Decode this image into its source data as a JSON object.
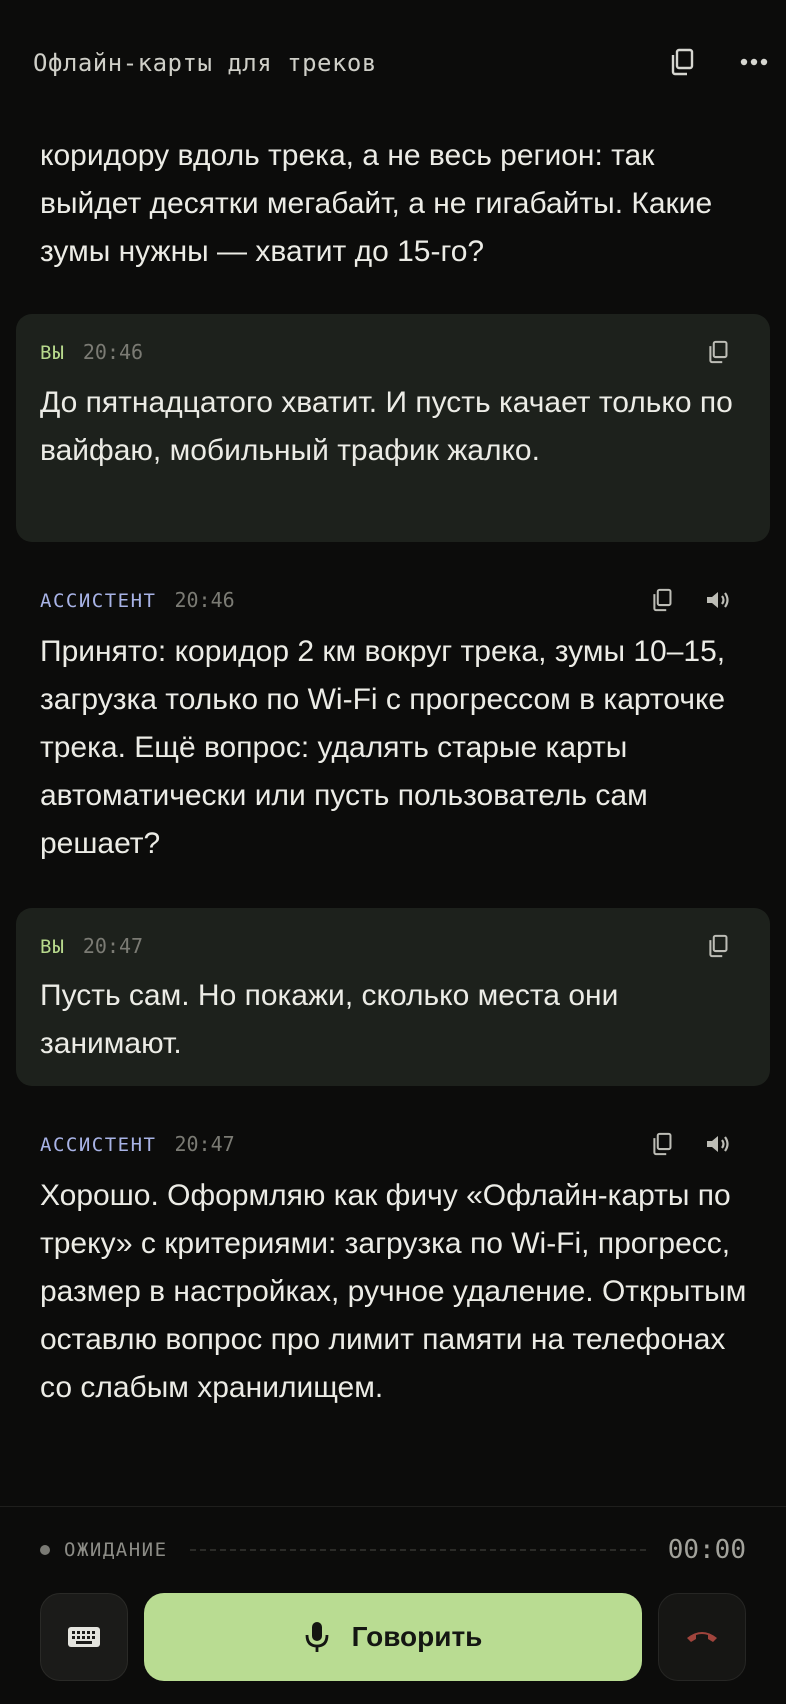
{
  "header": {
    "title": "Офлайн-карты для треков",
    "copy_icon": "copy-icon",
    "more_icon": "more-horizontal-icon"
  },
  "messages": [
    {
      "role": "assistant",
      "text": "коридору вдоль трека, а не весь регион: так выйдет десятки мегабайт, а не гигабайты. Какие зумы нужны — хватит до 15-го?"
    },
    {
      "role": "user",
      "role_label": "ВЫ",
      "time": "20:46",
      "text": "До пятнадцатого хватит. И пусть качает только по вайфаю, мобильный трафик жалко."
    },
    {
      "role": "assistant",
      "role_label": "АССИСТЕНТ",
      "time": "20:46",
      "text": "Принято: коридор 2 км вокруг трека, зумы 10–15, загрузка только по Wi-Fi с прогрессом в карточке трека. Ещё вопрос: удалять старые карты автоматически или пусть пользователь сам решает?"
    },
    {
      "role": "user",
      "role_label": "ВЫ",
      "time": "20:47",
      "text": "Пусть сам. Но покажи, сколько места они занимают."
    },
    {
      "role": "assistant",
      "role_label": "АССИСТЕНТ",
      "time": "20:47",
      "text": "Хорошо. Оформляю как фичу «Офлайн-карты по треку» с критериями: загрузка по Wi-Fi, прогресс, размер в настройках, ручное удаление. Открытым оставлю вопрос про лимит памяти на телефонах со слабым хранилищем."
    }
  ],
  "status": {
    "label": "ОЖИДАНИЕ",
    "timer": "00:00"
  },
  "controls": {
    "speak_label": "Говорить",
    "keyboard_icon": "keyboard-icon",
    "mic_icon": "microphone-icon",
    "hangup_icon": "phone-hangup-icon"
  },
  "colors": {
    "background": "#0c0c0b",
    "user_bubble": "#1d211c",
    "user_label": "#b7d98c",
    "assistant_label": "#a8b3e6",
    "speak_button": "#b9dc92",
    "hangup_icon": "#a0443c"
  }
}
